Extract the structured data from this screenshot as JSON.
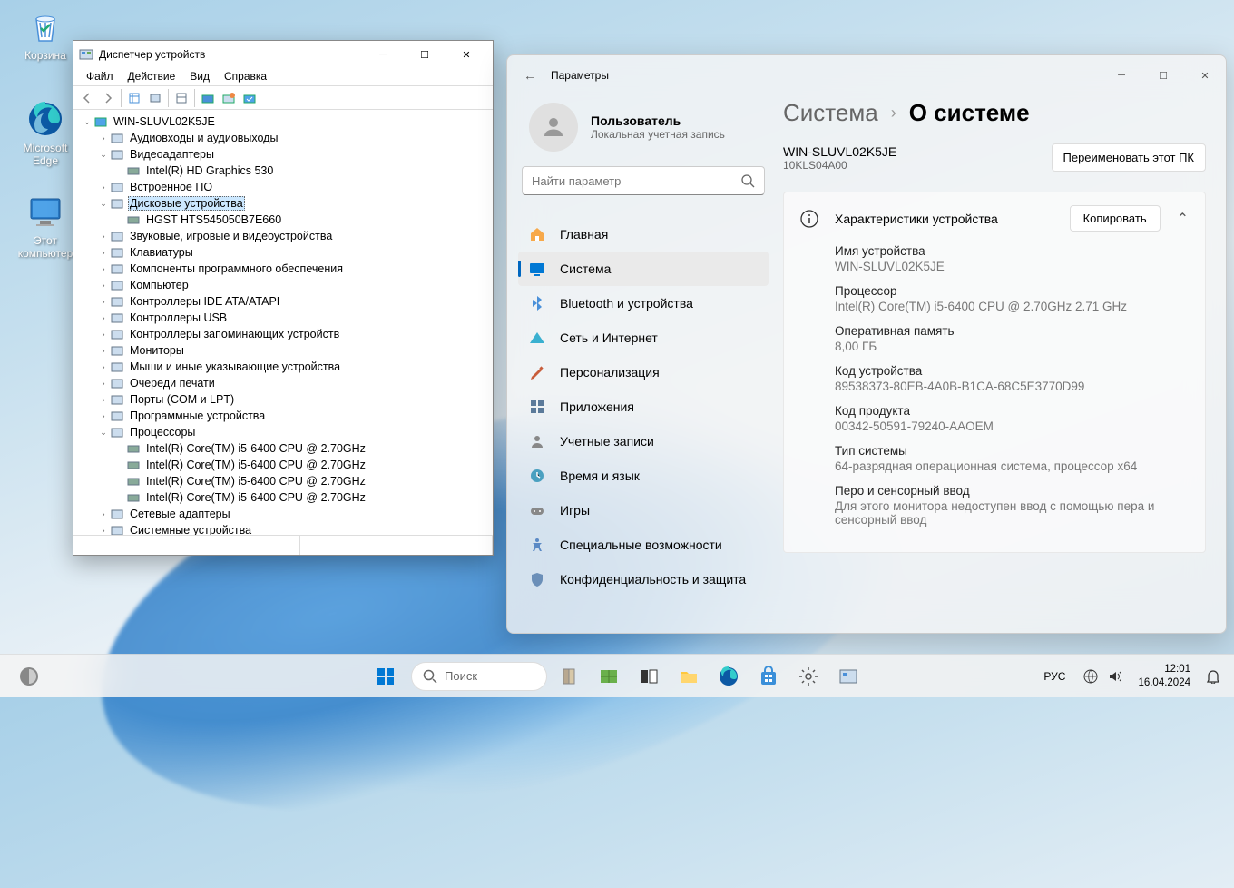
{
  "desktop": {
    "icons": [
      {
        "name": "recycle-bin",
        "label": "Корзина"
      },
      {
        "name": "edge",
        "label": "Microsoft Edge"
      },
      {
        "name": "this-pc",
        "label": "Этот компьютер"
      }
    ]
  },
  "devmgr": {
    "title": "Диспетчер устройств",
    "menu": [
      "Файл",
      "Действие",
      "Вид",
      "Справка"
    ],
    "root": "WIN-SLUVL02K5JE",
    "tree": [
      {
        "depth": 1,
        "exp": ">",
        "label": "Аудиовходы и аудиовыходы"
      },
      {
        "depth": 1,
        "exp": "v",
        "label": "Видеоадаптеры"
      },
      {
        "depth": 2,
        "exp": "",
        "label": "Intel(R) HD Graphics 530"
      },
      {
        "depth": 1,
        "exp": ">",
        "label": "Встроенное ПО"
      },
      {
        "depth": 1,
        "exp": "v",
        "label": "Дисковые устройства",
        "selected": true
      },
      {
        "depth": 2,
        "exp": "",
        "label": "HGST HTS545050B7E660"
      },
      {
        "depth": 1,
        "exp": ">",
        "label": "Звуковые, игровые и видеоустройства"
      },
      {
        "depth": 1,
        "exp": ">",
        "label": "Клавиатуры"
      },
      {
        "depth": 1,
        "exp": ">",
        "label": "Компоненты программного обеспечения"
      },
      {
        "depth": 1,
        "exp": ">",
        "label": "Компьютер"
      },
      {
        "depth": 1,
        "exp": ">",
        "label": "Контроллеры IDE ATA/ATAPI"
      },
      {
        "depth": 1,
        "exp": ">",
        "label": "Контроллеры USB"
      },
      {
        "depth": 1,
        "exp": ">",
        "label": "Контроллеры запоминающих устройств"
      },
      {
        "depth": 1,
        "exp": ">",
        "label": "Мониторы"
      },
      {
        "depth": 1,
        "exp": ">",
        "label": "Мыши и иные указывающие устройства"
      },
      {
        "depth": 1,
        "exp": ">",
        "label": "Очереди печати"
      },
      {
        "depth": 1,
        "exp": ">",
        "label": "Порты (COM и LPT)"
      },
      {
        "depth": 1,
        "exp": ">",
        "label": "Программные устройства"
      },
      {
        "depth": 1,
        "exp": "v",
        "label": "Процессоры"
      },
      {
        "depth": 2,
        "exp": "",
        "label": "Intel(R) Core(TM) i5-6400 CPU @ 2.70GHz"
      },
      {
        "depth": 2,
        "exp": "",
        "label": "Intel(R) Core(TM) i5-6400 CPU @ 2.70GHz"
      },
      {
        "depth": 2,
        "exp": "",
        "label": "Intel(R) Core(TM) i5-6400 CPU @ 2.70GHz"
      },
      {
        "depth": 2,
        "exp": "",
        "label": "Intel(R) Core(TM) i5-6400 CPU @ 2.70GHz"
      },
      {
        "depth": 1,
        "exp": ">",
        "label": "Сетевые адаптеры"
      },
      {
        "depth": 1,
        "exp": ">",
        "label": "Системные устройства"
      }
    ]
  },
  "settings": {
    "title": "Параметры",
    "user": {
      "name": "Пользователь",
      "type": "Локальная учетная запись"
    },
    "search_placeholder": "Найти параметр",
    "nav": [
      {
        "icon": "home",
        "label": "Главная",
        "color": "#f7a94a"
      },
      {
        "icon": "system",
        "label": "Система",
        "color": "#0078d4",
        "active": true
      },
      {
        "icon": "bluetooth",
        "label": "Bluetooth и устройства",
        "color": "#4a90d9"
      },
      {
        "icon": "network",
        "label": "Сеть и Интернет",
        "color": "#3ab0d0"
      },
      {
        "icon": "personalize",
        "label": "Персонализация",
        "color": "#c85c3a"
      },
      {
        "icon": "apps",
        "label": "Приложения",
        "color": "#5b7a9a"
      },
      {
        "icon": "accounts",
        "label": "Учетные записи",
        "color": "#888"
      },
      {
        "icon": "time",
        "label": "Время и язык",
        "color": "#4aa0c0"
      },
      {
        "icon": "gaming",
        "label": "Игры",
        "color": "#888"
      },
      {
        "icon": "accessibility",
        "label": "Специальные возможности",
        "color": "#5b8ac5"
      },
      {
        "icon": "privacy",
        "label": "Конфиденциальность и защита",
        "color": "#6b8fb8"
      }
    ],
    "breadcrumb": {
      "parent": "Система",
      "current": "О системе"
    },
    "device": {
      "name": "WIN-SLUVL02K5JE",
      "model": "10KLS04A00",
      "rename_btn": "Переименовать этот ПК"
    },
    "card": {
      "title": "Характеристики устройства",
      "copy_btn": "Копировать"
    },
    "specs": [
      {
        "k": "Имя устройства",
        "v": "WIN-SLUVL02K5JE"
      },
      {
        "k": "Процессор",
        "v": "Intel(R) Core(TM) i5-6400 CPU @ 2.70GHz   2.71 GHz"
      },
      {
        "k": "Оперативная память",
        "v": "8,00 ГБ"
      },
      {
        "k": "Код устройства",
        "v": "89538373-80EB-4A0B-B1CA-68C5E3770D99"
      },
      {
        "k": "Код продукта",
        "v": "00342-50591-79240-AAOEM"
      },
      {
        "k": "Тип системы",
        "v": "64-разрядная операционная система, процессор x64"
      },
      {
        "k": "Перо и сенсорный ввод",
        "v": "Для этого монитора недоступен ввод с помощью пера и сенсорный ввод"
      }
    ]
  },
  "taskbar": {
    "search": "Поиск",
    "lang": "РУС",
    "time": "12:01",
    "date": "16.04.2024"
  }
}
